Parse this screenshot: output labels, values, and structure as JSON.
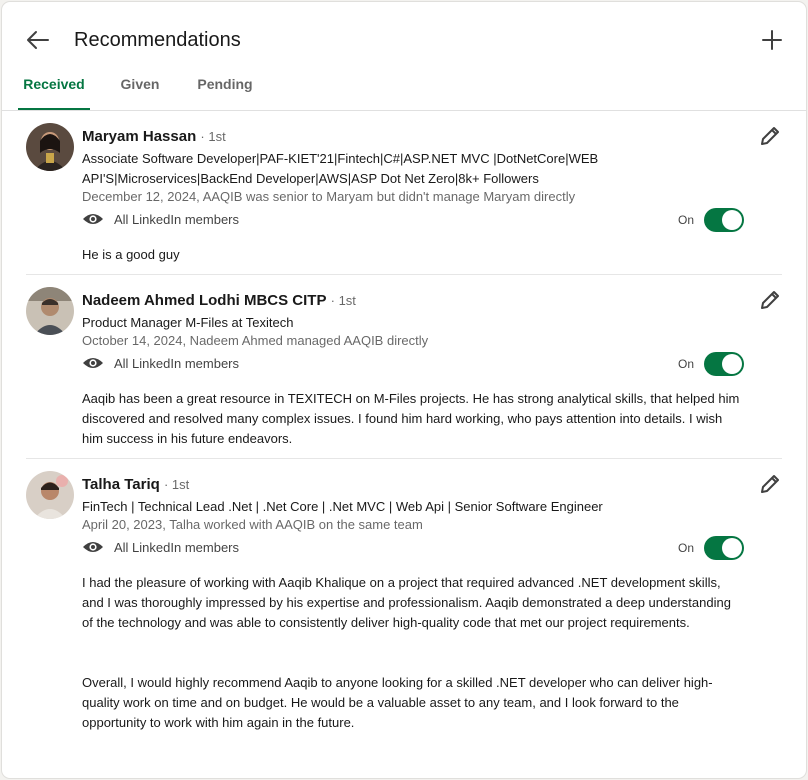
{
  "header": {
    "title": "Recommendations",
    "back_icon": "arrow-left-icon",
    "add_icon": "plus-icon"
  },
  "tabs": [
    {
      "label": "Received",
      "active": true
    },
    {
      "label": "Given",
      "active": false
    },
    {
      "label": "Pending",
      "active": false
    }
  ],
  "colors": {
    "accent": "#057642"
  },
  "recommendations": [
    {
      "name": "Maryam Hassan",
      "degree": "· 1st",
      "headline": "Associate Software Developer|PAF-KIET'21|Fintech|C#|ASP.NET MVC |DotNetCore|WEB API'S|Microservices|BackEnd Developer|AWS|ASP Dot Net Zero|8k+ Followers",
      "meta": "December 12, 2024, AAQIB was senior to Maryam but didn't manage Maryam directly",
      "visibility": "All LinkedIn members",
      "toggle_label": "On",
      "text": "He is a good guy"
    },
    {
      "name": "Nadeem Ahmed Lodhi MBCS CITP",
      "degree": "· 1st",
      "headline": "Product Manager M-Files at Texitech",
      "meta": "October 14, 2024, Nadeem Ahmed managed AAQIB directly",
      "visibility": "All LinkedIn members",
      "toggle_label": "On",
      "text": "Aaqib has been a great resource in TEXITECH on M-Files projects. He has strong analytical skills, that helped him discovered and resolved many complex issues. I found him hard working, who pays attention into details. I wish him success in his future endeavors."
    },
    {
      "name": "Talha Tariq",
      "degree": "· 1st",
      "headline": "FinTech | Technical Lead .Net | .Net Core | .Net MVC | Web Api | Senior Software Engineer",
      "meta": "April 20, 2023, Talha worked with AAQIB on the same team",
      "visibility": "All LinkedIn members",
      "toggle_label": "On",
      "text": "I had the pleasure of working with Aaqib Khalique on a project that required advanced .NET development skills, and I was thoroughly impressed by his expertise and professionalism. Aaqib demonstrated a deep understanding of the technology and was able to consistently deliver high-quality code that met our project requirements.\n\n\nOverall, I would highly recommend Aaqib to anyone looking for a skilled .NET developer who can deliver high-quality work on time and on budget. He would be a valuable asset to any team, and I look forward to the opportunity to work with him again in the future."
    }
  ]
}
